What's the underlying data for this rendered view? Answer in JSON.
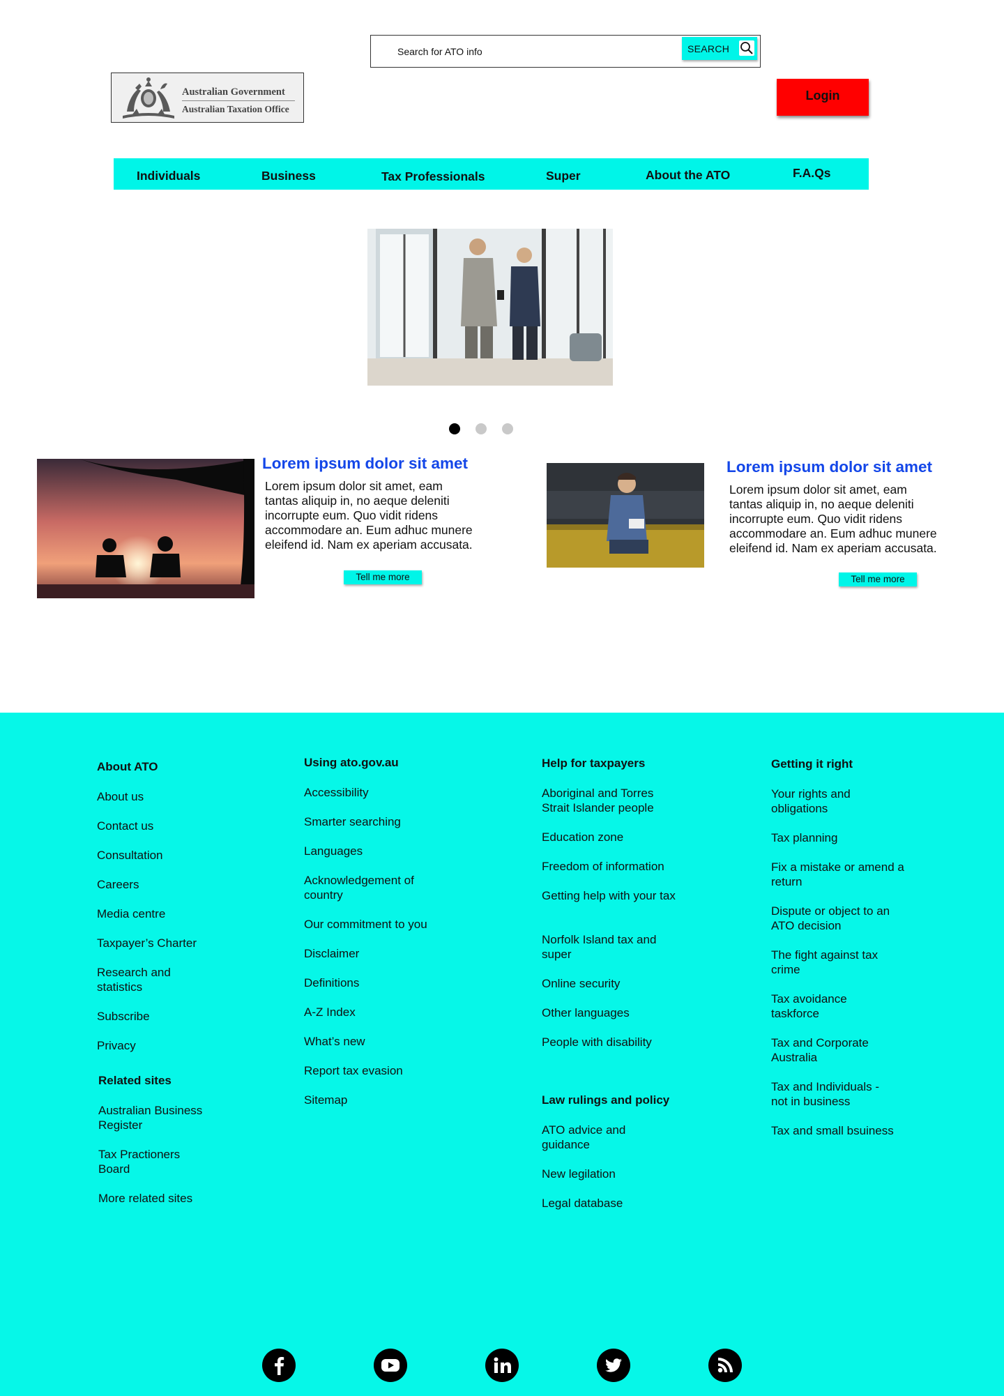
{
  "header": {
    "search": {
      "placeholder": "Search for ATO info",
      "button_label": "SEARCH"
    },
    "logo": {
      "line1": "Australian Government",
      "line2": "Australian Taxation Office"
    },
    "login_label": "Login"
  },
  "nav": {
    "items": [
      {
        "label": "Individuals"
      },
      {
        "label": "Business"
      },
      {
        "label": "Tax Professionals"
      },
      {
        "label": "Super"
      },
      {
        "label": "About the ATO"
      },
      {
        "label": "F.A.Qs"
      }
    ]
  },
  "carousel": {
    "slide_count": 3,
    "active_index": 0
  },
  "articles": [
    {
      "title": "Lorem ipsum dolor sit amet",
      "body": "Lorem ipsum dolor sit amet, eam tantas aliquip in, no aeque deleniti incorrupte eum. Quo vidit ridens accommodare an. Eum adhuc munere eleifend id. Nam ex aperiam accusata.",
      "button_label": "Tell me more"
    },
    {
      "title": "Lorem ipsum dolor sit amet",
      "body": "Lorem ipsum dolor sit amet, eam tantas aliquip in, no aeque deleniti incorrupte eum. Quo vidit ridens accommodare an. Eum adhuc munere eleifend id. Nam ex aperiam accusata.",
      "button_label": "Tell me more"
    }
  ],
  "footer": {
    "about": {
      "heading": "About ATO",
      "links": [
        "About us",
        "Contact us",
        "Consultation",
        "Careers",
        "Media centre",
        "Taxpayer’s Charter",
        "Research and statistics",
        "Subscribe",
        "Privacy"
      ]
    },
    "related": {
      "heading": "Related sites",
      "links": [
        "Australian Business Register",
        "Tax Practioners Board",
        "More related sites"
      ]
    },
    "using": {
      "heading": "Using ato.gov.au",
      "links": [
        "Accessibility",
        "Smarter searching",
        "Languages",
        "Acknowledgement of country",
        "Our commitment to you",
        "Disclaimer",
        "Definitions",
        "A-Z Index",
        "What’s new",
        "Report tax evasion",
        "Sitemap"
      ]
    },
    "help": {
      "heading": "Help for taxpayers",
      "links": [
        "Aboriginal and Torres Strait Islander people",
        "Education zone",
        "Freedom of information",
        "Getting  help with your tax",
        "Norfolk Island tax and super",
        "Online security",
        "Other languages",
        "People with disability"
      ]
    },
    "law": {
      "heading": "Law rulings and policy",
      "links": [
        "ATO advice and guidance",
        "New legilation",
        "Legal database"
      ]
    },
    "getting": {
      "heading": "Getting it right",
      "links": [
        "Your rights and obligations",
        "Tax planning",
        "Fix a mistake or amend a return",
        "Dispute or object to an ATO decision",
        "The fight against tax crime",
        "Tax avoidance taskforce",
        "Tax and Corporate Australia",
        "Tax and Individuals - not in business",
        "Tax and small bsuiness"
      ]
    },
    "social": [
      "facebook-icon",
      "youtube-icon",
      "linkedin-icon",
      "twitter-icon",
      "rss-icon"
    ]
  },
  "colors": {
    "accent": "#00f5e8",
    "login": "#ff0000",
    "title_blue": "#1346e8"
  }
}
